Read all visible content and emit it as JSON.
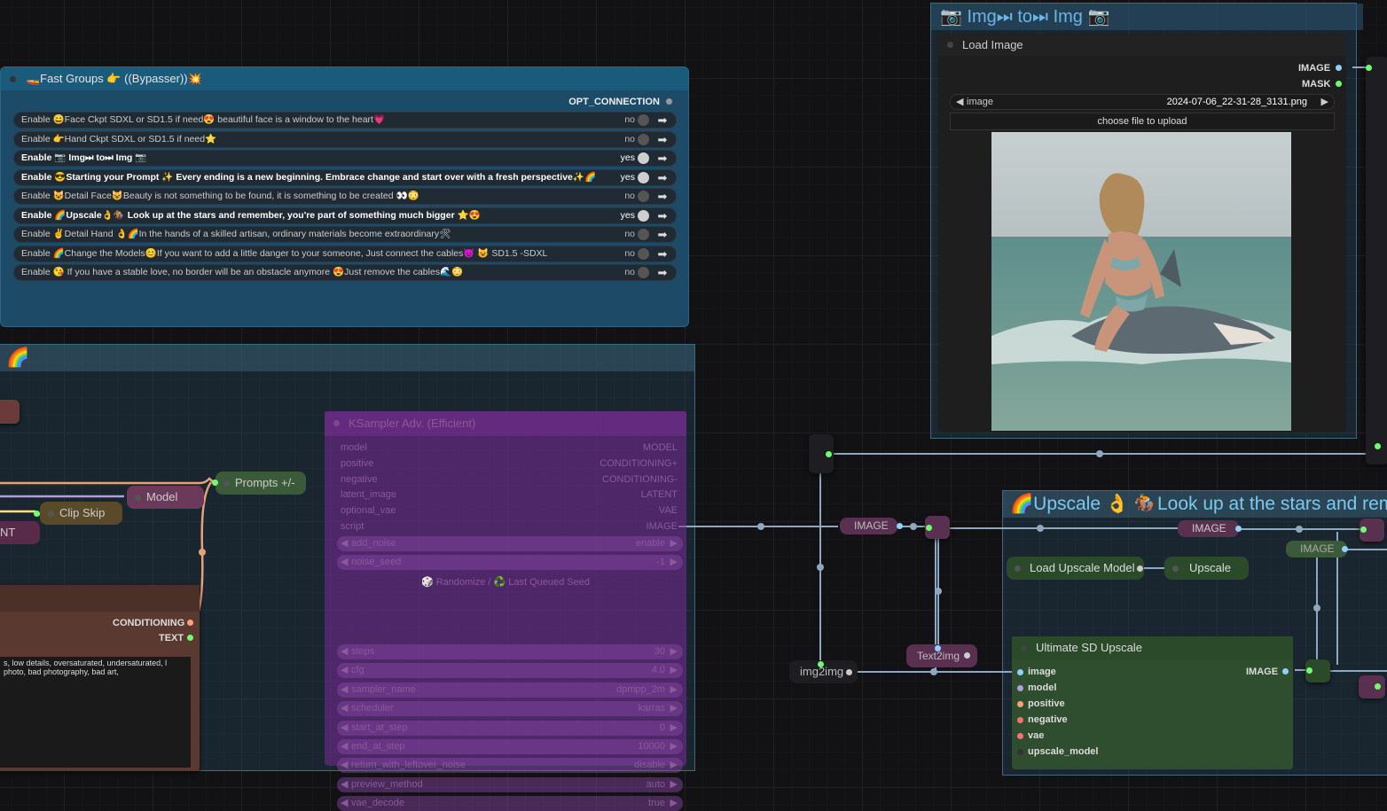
{
  "fast_groups": {
    "title": "🚤Fast Groups 👉 ((Bypasser))💥",
    "output": "OPT_CONNECTION",
    "rows": [
      {
        "label": "Enable 😄Face Ckpt SDXL or SD1.5 if need😍 beautiful face is a window to the heart💗",
        "state": "no",
        "on": false
      },
      {
        "label": "Enable 👉Hand Ckpt SDXL or SD1.5 if need⭐",
        "state": "no",
        "on": false
      },
      {
        "label": "Enable 📷 Img⏭ to⏭ Img 📷",
        "state": "yes",
        "on": true
      },
      {
        "label": "Enable 😎Starting your Prompt ✨ Every ending is a new beginning. Embrace change and start over with a fresh perspective✨🌈",
        "state": "yes",
        "on": true
      },
      {
        "label": "Enable 😺Detail Face😺Beauty is not something to be found, it is something to be created 👀😳",
        "state": "no",
        "on": false
      },
      {
        "label": "Enable 🌈Upscale👌🏇 Look up at the stars and remember, you're part of something much bigger ⭐😍",
        "state": "yes",
        "on": true
      },
      {
        "label": "Enable ✌Detail Hand 👌🌈In the hands of a skilled artisan, ordinary materials become extraordinary🛠",
        "state": "no",
        "on": false
      },
      {
        "label": "Enable 🌈Change the Models😊If you want to add a little danger to your someone, Just connect the cables😈 😺 SD1.5 -SDXL",
        "state": "no",
        "on": false
      },
      {
        "label": "Enable 😘 If you have a stable love, no border will be an obstacle anymore 😍Just remove the cables🌊😳",
        "state": "no",
        "on": false
      }
    ]
  },
  "img2img_group": {
    "title": "📷 Img⏭ to⏭ Img 📷"
  },
  "load_image": {
    "title": "Load Image",
    "outputs": [
      "IMAGE",
      "MASK"
    ],
    "widget_name": "image",
    "widget_value": "2024-07-06_22-31-28_3131.png",
    "upload_label": "choose file to upload"
  },
  "upscale_group": {
    "title": "🌈Upscale 👌 🏇Look up at the stars and remember"
  },
  "prompt_group": {
    "title": "🌈"
  },
  "nodes": {
    "prompts": "Prompts +/-",
    "model": "Model",
    "clip_skip": "Clip Skip",
    "nt": "NT",
    "load_upscale_model": "Load Upscale Model",
    "upscale": "Upscale",
    "img2img": "img2img",
    "text2img": "Text2img",
    "image_a": "IMAGE",
    "image_b": "IMAGE",
    "image_c": "IMAGE"
  },
  "clip_node": {
    "outputs": [
      "CONDITIONING",
      "TEXT"
    ],
    "text": "s, low details, oversaturated, undersaturated, l photo, bad photography, bad art,"
  },
  "ksampler": {
    "title": "KSampler Adv. (Efficient)",
    "inputs": [
      "model",
      "positive",
      "negative",
      "latent_image",
      "optional_vae",
      "script"
    ],
    "outputs": [
      "MODEL",
      "CONDITIONING+",
      "CONDITIONING-",
      "LATENT",
      "VAE",
      "IMAGE"
    ],
    "widgets": [
      {
        "k": "add_noise",
        "v": "enable"
      },
      {
        "k": "noise_seed",
        "v": "-1"
      },
      {
        "k": "steps",
        "v": "30"
      },
      {
        "k": "cfg",
        "v": "4.0"
      },
      {
        "k": "sampler_name",
        "v": "dpmpp_2m"
      },
      {
        "k": "scheduler",
        "v": "karras"
      },
      {
        "k": "start_at_step",
        "v": "0"
      },
      {
        "k": "end_at_step",
        "v": "10000"
      },
      {
        "k": "return_with_leftover_noise",
        "v": "disable"
      },
      {
        "k": "preview_method",
        "v": "auto"
      },
      {
        "k": "vae_decode",
        "v": "true"
      }
    ],
    "seed_buttons": "🎲 Randomize / ♻️ Last Queued Seed"
  },
  "ultimate_upscale": {
    "title": "Ultimate SD Upscale",
    "inputs": [
      {
        "name": "image",
        "color": "#8fd0ff"
      },
      {
        "name": "model",
        "color": "#b39ddb"
      },
      {
        "name": "positive",
        "color": "#ffa07a"
      },
      {
        "name": "negative",
        "color": "#ff6f6f"
      },
      {
        "name": "vae",
        "color": "#ff7070"
      },
      {
        "name": "upscale_model",
        "color": "#333333"
      }
    ],
    "output": "IMAGE"
  },
  "colors": {
    "link": "#8fa8c0",
    "green_dot": "#6dff6d",
    "accent": "#6ab4e6"
  }
}
